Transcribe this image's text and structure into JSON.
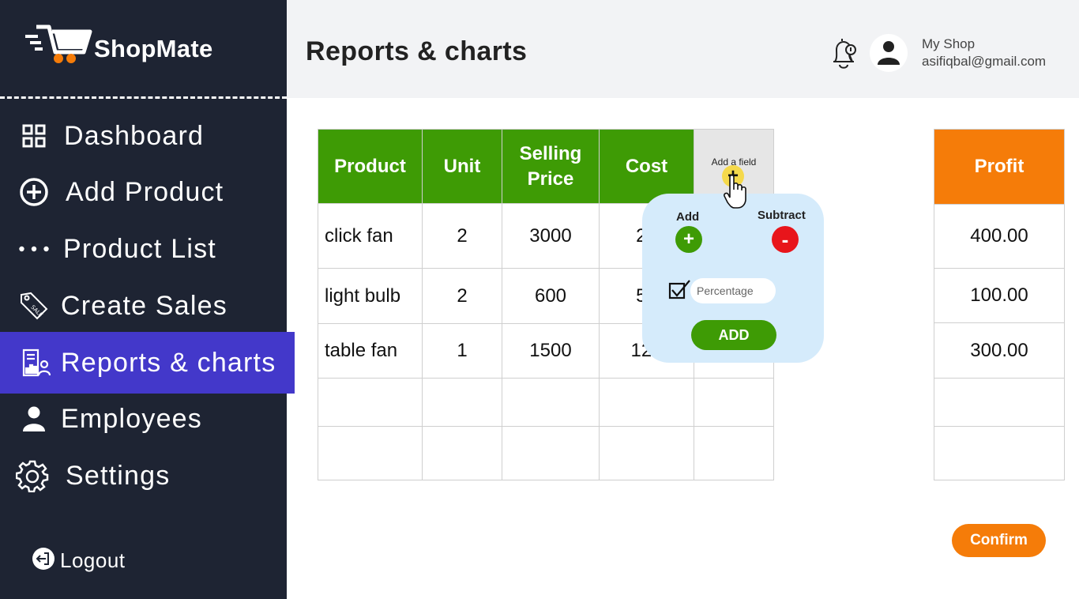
{
  "brand": {
    "name": "ShopMate",
    "accent": "#f57c09"
  },
  "sidebar": {
    "items": [
      {
        "label": "Dashboard",
        "icon": "grid-icon"
      },
      {
        "label": "Add Product",
        "icon": "plus-circle-icon"
      },
      {
        "label": "Product List",
        "icon": "dots-icon"
      },
      {
        "label": "Create Sales",
        "icon": "sale-tag-icon"
      },
      {
        "label": "Reports & charts",
        "icon": "report-icon",
        "active": true
      },
      {
        "label": "Employees",
        "icon": "person-icon"
      },
      {
        "label": "Settings",
        "icon": "gear-icon"
      }
    ],
    "logout": "Logout",
    "active_color": "#4338ca",
    "bg_color": "#1e2433"
  },
  "header": {
    "title": "Reports & charts",
    "shop_name": "My Shop",
    "email": "asifiqbal@gmail.com"
  },
  "table": {
    "columns": [
      "Product",
      "Unit",
      "Selling Price",
      "Cost"
    ],
    "add_field_label": "Add a field",
    "rows": [
      {
        "product": "click fan",
        "unit": "2",
        "selling_price": "3000",
        "cost": "28"
      },
      {
        "product": "light bulb",
        "unit": "2",
        "selling_price": "600",
        "cost": "55"
      },
      {
        "product": "table fan",
        "unit": "1",
        "selling_price": "1500",
        "cost": "120"
      }
    ],
    "header_color": "#3e9b05"
  },
  "profit": {
    "header": "Profit",
    "values": [
      "400.00",
      "100.00",
      "300.00"
    ],
    "header_color": "#f57c09"
  },
  "popup": {
    "add_label": "Add",
    "subtract_label": "Subtract",
    "add_symbol": "+",
    "subtract_symbol": "-",
    "percentage_placeholder": "Percentage",
    "percentage_checked": true,
    "add_button": "ADD"
  },
  "confirm_button": "Confirm"
}
